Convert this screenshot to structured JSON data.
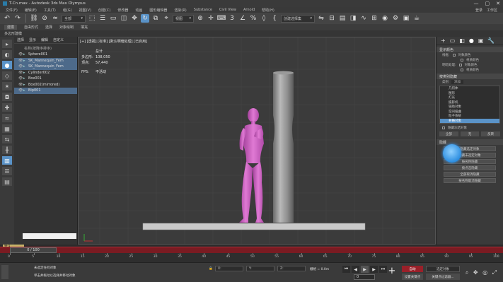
{
  "window": {
    "title": "T-Cn.max - Autodesk 3ds Max Olympus",
    "minimize": "—",
    "maximize": "▢",
    "close": "✕"
  },
  "menubar": {
    "items": [
      "文件(F)",
      "编辑(E)",
      "工具(T)",
      "组(G)",
      "视图(V)",
      "创建(C)",
      "修改器",
      "动画",
      "图形编辑器",
      "渲染(R)",
      "Substance",
      "Civil View",
      "Arnold",
      "帮助(H)"
    ],
    "right": [
      "登录",
      "工作区"
    ]
  },
  "toolbar": {
    "filter_dropdown": "全部",
    "coord_dropdown": "视图",
    "selection_set": "创建选择集"
  },
  "ribbon": {
    "tab_active": "建模",
    "tabs": [
      "自由形式",
      "选择",
      "对象绘制",
      "填充"
    ],
    "sub": "多边形建模"
  },
  "scene_explorer": {
    "tabs": [
      "选择",
      "显示",
      "编辑",
      "自定义"
    ],
    "header": "名称(按降序排序)",
    "items": [
      {
        "name": "Sphere001",
        "selected": false
      },
      {
        "name": "SK_Mannequin_Fem",
        "selected": true
      },
      {
        "name": "SK_Mannequin_Fem",
        "selected": true
      },
      {
        "name": "Cylinder002",
        "selected": false
      },
      {
        "name": "Box001",
        "selected": false
      },
      {
        "name": "Box002(mirrored)",
        "selected": false
      },
      {
        "name": "Bip001",
        "selected": true
      }
    ],
    "layer_label": "默认"
  },
  "viewport": {
    "label": "[+] [透视] [标准] [默认明暗处理] [已启用]",
    "stats_title": "总计",
    "stats": [
      {
        "label": "多边形:",
        "value": "108,050"
      },
      {
        "label": "顶点:",
        "value": "57,440"
      }
    ],
    "fps_label": "FPS:",
    "fps_value": "不活动"
  },
  "command_panel": {
    "tabs": [
      "+",
      "▭",
      "◧",
      "●",
      "▣",
      "🔧"
    ],
    "rollout1": "显示颜色",
    "wire_label": "线框:",
    "wire_opts": [
      "对象颜色",
      "材质颜色"
    ],
    "shaded_label": "明暗处理:",
    "shaded_opts": [
      "对象颜色",
      "材质颜色"
    ],
    "rollout2": "按类别隐藏",
    "cat_header": "类别",
    "cat_hint": "添加",
    "categories": [
      {
        "name": "几何体",
        "selected": false
      },
      {
        "name": "图形",
        "selected": false
      },
      {
        "name": "灯光",
        "selected": false
      },
      {
        "name": "摄影机",
        "selected": false
      },
      {
        "name": "辅助对象",
        "selected": false
      },
      {
        "name": "空间扭曲",
        "selected": false
      },
      {
        "name": "粒子系统",
        "selected": false
      },
      {
        "name": "骨骼对象",
        "selected": true
      }
    ],
    "cat_buttons": [
      "全部",
      "无",
      "反转"
    ],
    "rollout3": "隐藏",
    "hide_buttons": [
      "隐藏选定对象",
      "隐藏未选定对象",
      "按名称隐藏",
      "按点击隐藏",
      "全部取消隐藏",
      "按名称取消隐藏"
    ],
    "hide_frozen": "隐藏冻结对象"
  },
  "timeslider": {
    "label": "0 / 100",
    "ticks": [
      "0",
      "5",
      "10",
      "15",
      "20",
      "25",
      "30",
      "35",
      "40",
      "45",
      "50",
      "55",
      "60",
      "65",
      "70",
      "75",
      "80",
      "85",
      "90",
      "95",
      "100"
    ]
  },
  "status": {
    "line1": "未选定任何对象",
    "line2": "单击并拖动以选择并移动对象",
    "x_label": "X:",
    "y_label": "Y:",
    "z_label": "Z:",
    "grid": "栅格 = 0.0m",
    "frame": "0",
    "autokey": "自动",
    "setkey": "设置关键点",
    "keyfilter": "选定对象",
    "keyfilter2": "关键点过滤器..."
  },
  "colors": {
    "accent": "#5a93c8",
    "figure": "#d264c4",
    "timeline_red": "#7a1b22"
  }
}
